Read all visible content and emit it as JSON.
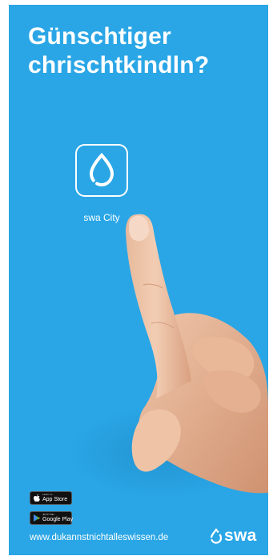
{
  "headline": {
    "line1": "Günschtiger",
    "line2": "chrischtkindln?"
  },
  "app": {
    "label": "swa City",
    "icon": "swa-drop-icon"
  },
  "stores": {
    "appstore": {
      "small": "Laden im",
      "big": "App Store",
      "icon": "apple-icon"
    },
    "googleplay": {
      "small": "JETZT BEI",
      "big": "Google Play",
      "icon": "play-icon"
    }
  },
  "footer": {
    "website": "www.dukannstnichtalleswissen.de",
    "brand": "swa",
    "brand_icon": "swa-drop-icon"
  },
  "colors": {
    "background": "#2aa6e6",
    "text": "#ffffff"
  }
}
